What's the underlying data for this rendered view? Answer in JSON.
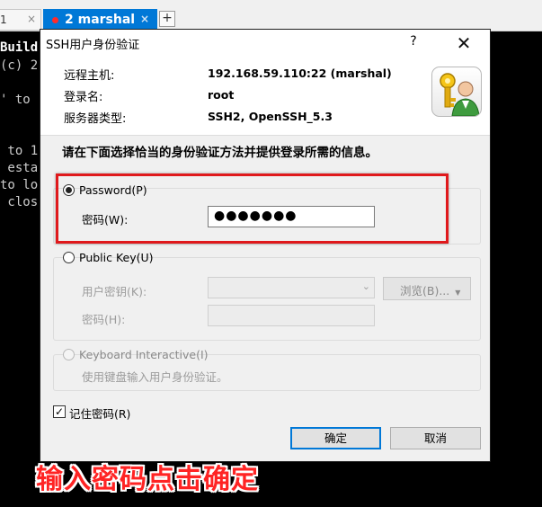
{
  "colors": {
    "accent": "#0078d7",
    "highlight": "#e0191c",
    "caption": "#ff2424"
  },
  "tabs": [
    {
      "label": "1",
      "close": "×"
    },
    {
      "label": "2 marshal",
      "close": "×",
      "active": true
    }
  ],
  "new_tab": "+",
  "terminal": {
    "lines": [
      "Build",
      "(c) 2",
      "' to ",
      " to 1",
      " esta",
      "to lo",
      " clos"
    ]
  },
  "dialog": {
    "title": "SSH用户身份验证",
    "help": "?",
    "close": "✕",
    "info": [
      {
        "label": "远程主机:",
        "value": "192.168.59.110:22 (marshal)"
      },
      {
        "label": "登录名:",
        "value": "root"
      },
      {
        "label": "服务器类型:",
        "value": "SSH2, OpenSSH_5.3"
      }
    ],
    "icon": "user-key-icon",
    "instruction": "请在下面选择恰当的身份验证方法并提供登录所需的信息。",
    "password": {
      "option_label": "Password(P)",
      "selected": true,
      "field_label": "密码(W):",
      "value": "●●●●●●●"
    },
    "public_key": {
      "option_label": "Public Key(U)",
      "key_label": "用户密钥(K):",
      "key_value": "",
      "browse_label": "浏览(B)...",
      "passphrase_label": "密码(H):",
      "passphrase_value": ""
    },
    "keyboard": {
      "option_label": "Keyboard Interactive(I)",
      "description": "使用键盘输入用户身份验证。"
    },
    "remember": {
      "label": "记住密码(R)",
      "checked": true,
      "mark": "✓"
    },
    "ok_label": "确定",
    "cancel_label": "取消"
  },
  "caption": "输入密码点击确定"
}
